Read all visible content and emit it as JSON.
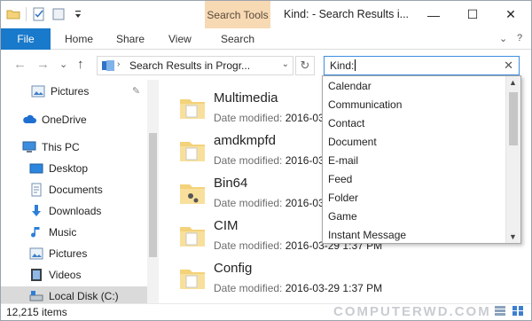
{
  "window": {
    "title": "Kind: - Search Results i...",
    "context_tab": "Search Tools",
    "controls": {
      "minimize": "—",
      "maximize": "☐",
      "close": "✕"
    }
  },
  "ribbon": {
    "tabs": [
      "File",
      "Home",
      "Share",
      "View",
      "Search"
    ],
    "expand_glyph": "⌄",
    "help_glyph": "?"
  },
  "navigation": {
    "back": "←",
    "forward": "→",
    "history": "⌄",
    "up": "↑",
    "address": "Search Results in Progr...",
    "address_dropdown": "⌄",
    "refresh": "↻"
  },
  "search": {
    "value": "Kind:",
    "clear": "✕"
  },
  "nav_pane": {
    "items": [
      {
        "label": "Pictures",
        "icon": "pictures-icon",
        "pinned": true
      },
      {
        "label": "OneDrive",
        "icon": "onedrive-cloud-icon"
      },
      {
        "label": "This PC",
        "icon": "computer-icon"
      },
      {
        "label": "Desktop",
        "icon": "desktop-icon"
      },
      {
        "label": "Documents",
        "icon": "documents-icon"
      },
      {
        "label": "Downloads",
        "icon": "downloads-icon"
      },
      {
        "label": "Music",
        "icon": "music-icon"
      },
      {
        "label": "Pictures",
        "icon": "pictures-icon"
      },
      {
        "label": "Videos",
        "icon": "videos-icon"
      },
      {
        "label": "Local Disk (C:)",
        "icon": "drive-icon",
        "selected": true
      }
    ],
    "pin_glyph": "📌"
  },
  "files": [
    {
      "name": "Multimedia",
      "modified_label": "Date modified:",
      "modified": "2016-03"
    },
    {
      "name": "amdkmpfd",
      "modified_label": "Date modified:",
      "modified": "2016-03"
    },
    {
      "name": "Bin64",
      "modified_label": "Date modified:",
      "modified": "2016-03"
    },
    {
      "name": "CIM",
      "modified_label": "Date modified:",
      "modified": "2016-03-29 1:37 PM"
    },
    {
      "name": "Config",
      "modified_label": "Date modified:",
      "modified": "2016-03-29 1:37 PM"
    }
  ],
  "kind_dropdown": {
    "options": [
      "Calendar",
      "Communication",
      "Contact",
      "Document",
      "E-mail",
      "Feed",
      "Folder",
      "Game",
      "Instant Message"
    ],
    "scroll_up": "▲",
    "scroll_down": "▼"
  },
  "status": {
    "item_count": "12,215 items"
  },
  "watermark": "COMPUTERWD.COM",
  "colors": {
    "file_tab": "#1979ca",
    "context_tab": "#f7d9b4",
    "search_border": "#3d8ee0",
    "folder": "#f3d27a"
  }
}
